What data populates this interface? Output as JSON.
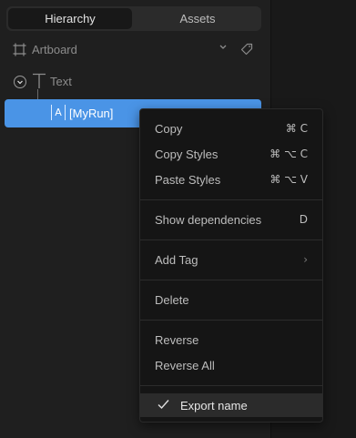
{
  "tabs": {
    "hierarchy": "Hierarchy",
    "assets": "Assets"
  },
  "tree": {
    "artboard_label": "Artboard",
    "text_label": "Text",
    "selected_label": "[MyRun]",
    "selected_icon_glyph": "A"
  },
  "menu": {
    "copy": "Copy",
    "copy_shortcut": "⌘ C",
    "copy_styles": "Copy Styles",
    "copy_styles_shortcut": "⌘ ⌥ C",
    "paste_styles": "Paste Styles",
    "paste_styles_shortcut": "⌘ ⌥ V",
    "show_dependencies": "Show dependencies",
    "show_dependencies_shortcut": "D",
    "add_tag": "Add Tag",
    "add_tag_arrow": "›",
    "delete": "Delete",
    "reverse": "Reverse",
    "reverse_all": "Reverse All",
    "export_name": "Export name"
  },
  "colors": {
    "selection": "#4a94e6",
    "menu_bg": "#151515",
    "panel_bg": "#1f1f1f"
  },
  "icons": {
    "artboard": "frame-icon",
    "tag": "tag-icon",
    "chevron": "chevron-down-icon",
    "expand": "collapse-chevron-icon",
    "text": "text-icon",
    "run": "text-run-icon",
    "check": "checkmark-icon",
    "submenu": "submenu-arrow-icon"
  }
}
